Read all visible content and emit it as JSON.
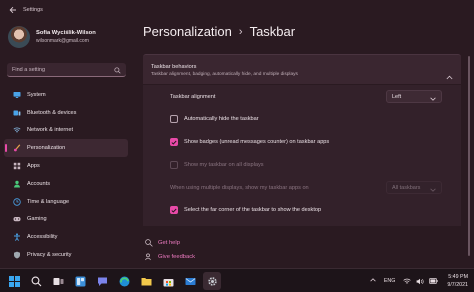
{
  "window": {
    "title": "Settings"
  },
  "profile": {
    "name": "Sofia Wyciślik-Wilson",
    "email": "wilsonmark@gmail.com"
  },
  "search": {
    "placeholder": "Find a setting"
  },
  "nav": [
    {
      "label": "System",
      "icon": "monitor-icon",
      "color": "#4aa3e8"
    },
    {
      "label": "Bluetooth & devices",
      "icon": "bluetooth-icon",
      "color": "#4aa3e8"
    },
    {
      "label": "Network & internet",
      "icon": "wifi-icon",
      "color": "#8ec4f0"
    },
    {
      "label": "Personalization",
      "icon": "brush-icon",
      "color": "#e8a04a",
      "active": true
    },
    {
      "label": "Apps",
      "icon": "apps-icon",
      "color": "#c8b6c0"
    },
    {
      "label": "Accounts",
      "icon": "person-icon",
      "color": "#4ac87a"
    },
    {
      "label": "Time & language",
      "icon": "clock-globe-icon",
      "color": "#4aa3e8"
    },
    {
      "label": "Gaming",
      "icon": "gamepad-icon",
      "color": "#c8b6c0"
    },
    {
      "label": "Accessibility",
      "icon": "accessibility-icon",
      "color": "#4aa3e8"
    },
    {
      "label": "Privacy & security",
      "icon": "shield-icon",
      "color": "#a0a8b0"
    }
  ],
  "breadcrumb": {
    "parent": "Personalization",
    "separator": "›",
    "current": "Taskbar"
  },
  "section": {
    "title": "Taskbar behaviors",
    "subtitle": "Taskbar alignment, badging, automatically hide, and multiple displays"
  },
  "settings": {
    "alignment_label": "Taskbar alignment",
    "alignment_value": "Left",
    "auto_hide_label": "Automatically hide the taskbar",
    "auto_hide_checked": false,
    "badges_label": "Show badges (unread messages counter) on taskbar apps",
    "badges_checked": true,
    "all_displays_label": "Show my taskbar on all displays",
    "all_displays_checked": false,
    "multi_display_label": "When using multiple displays, show my taskbar apps on",
    "multi_display_value": "All taskbars",
    "far_corner_label": "Select the far corner of the taskbar to show the desktop",
    "far_corner_checked": true
  },
  "links": {
    "help": "Get help",
    "feedback": "Give feedback"
  },
  "taskbar": {
    "apps": [
      "windows-start-icon",
      "search-icon",
      "task-view-icon",
      "widgets-icon",
      "chat-icon",
      "edge-icon",
      "file-explorer-icon",
      "store-icon",
      "mail-icon",
      "settings-icon"
    ],
    "active_app": "settings-icon"
  },
  "tray": {
    "language": "ENG",
    "time": "5:49 PM",
    "date": "9/7/2021"
  },
  "colors": {
    "accent": "#e84aa8",
    "link": "#ec7ac0",
    "background": "#2a1a21"
  }
}
